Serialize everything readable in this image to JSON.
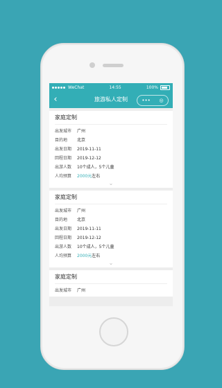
{
  "statusbar": {
    "carrier": "WeChat",
    "time": "14:55",
    "battery": "100%"
  },
  "navbar": {
    "title": "旅游私人定制",
    "back_icon": "‹",
    "menu": "•••",
    "target": "◎"
  },
  "cards": [
    {
      "title": "家庭定制",
      "rows": [
        {
          "label": "出发城市",
          "value": "广州"
        },
        {
          "label": "目的地",
          "value": "北京"
        },
        {
          "label": "出发日期",
          "value": "2019-11-11"
        },
        {
          "label": "回程日期",
          "value": "2019-12-12"
        },
        {
          "label": "出游人数",
          "value": "10个成人，5个儿童"
        },
        {
          "label": "人均预算",
          "value_price": "2000元",
          "value_suffix": "左右"
        }
      ]
    },
    {
      "title": "家庭定制",
      "rows": [
        {
          "label": "出发城市",
          "value": "广州"
        },
        {
          "label": "目的地",
          "value": "北京"
        },
        {
          "label": "出发日期",
          "value": "2019-11-11"
        },
        {
          "label": "回程日期",
          "value": "2019-12-12"
        },
        {
          "label": "出游人数",
          "value": "10个成人，5个儿童"
        },
        {
          "label": "人均预算",
          "value_price": "2000元",
          "value_suffix": "左右"
        }
      ]
    },
    {
      "title": "家庭定制",
      "rows": [
        {
          "label": "出发城市",
          "value": "广州"
        }
      ]
    }
  ]
}
